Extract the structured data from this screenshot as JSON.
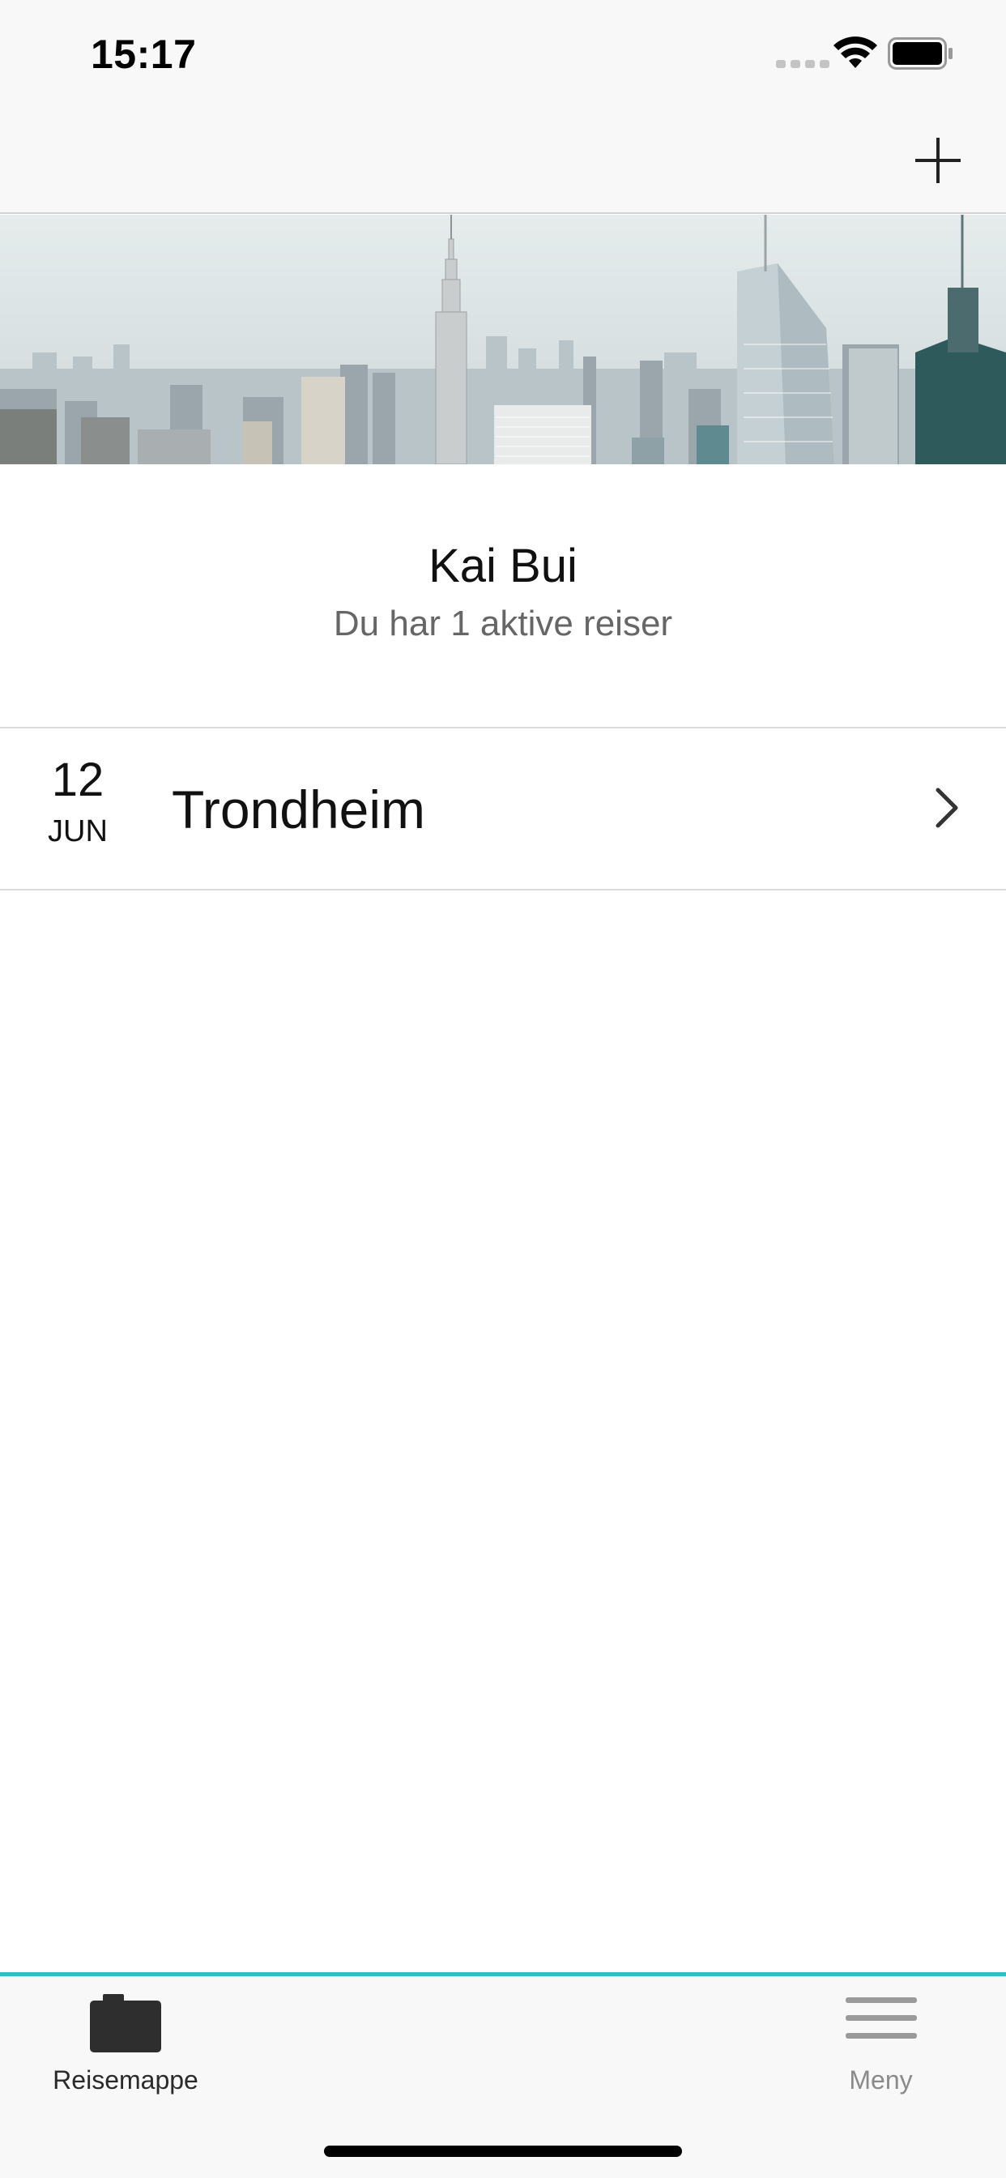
{
  "status_bar": {
    "time": "15:17",
    "icons": [
      "signal-icon",
      "wifi-icon",
      "battery-icon"
    ]
  },
  "nav_bar": {
    "add_icon": "plus-icon"
  },
  "hero": {
    "image": "city-skyline-image"
  },
  "profile": {
    "name": "Kai Bui",
    "subtitle": "Du har 1 aktive reiser"
  },
  "trips": [
    {
      "day": "12",
      "month": "JUN",
      "city": "Trondheim",
      "icon": "chevron-right-icon"
    }
  ],
  "tab_bar": {
    "accent_color": "#2bbec8",
    "tabs": [
      {
        "label": "Reisemappe",
        "icon": "briefcase-icon",
        "active": true
      },
      {
        "label": "Meny",
        "icon": "menu-icon",
        "active": false
      }
    ]
  }
}
